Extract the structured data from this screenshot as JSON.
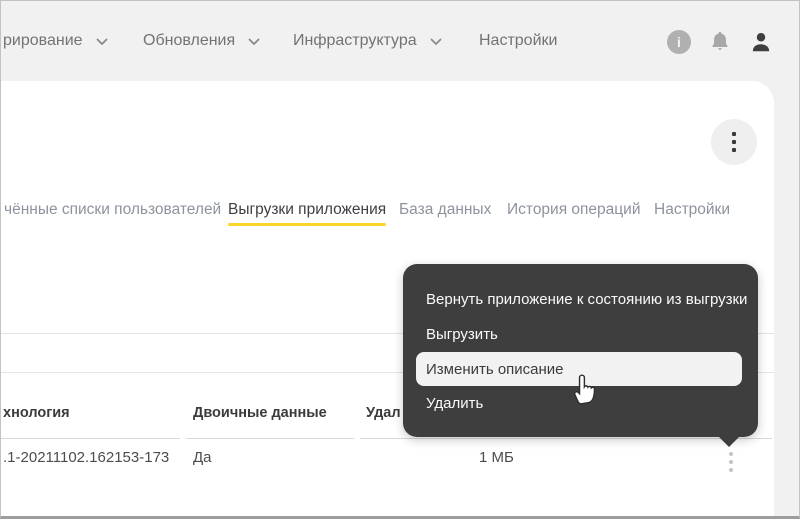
{
  "topnav": {
    "items": [
      {
        "label": "рирование",
        "has_chevron": true
      },
      {
        "label": "Обновления",
        "has_chevron": true
      },
      {
        "label": "Инфраструктура",
        "has_chevron": true
      },
      {
        "label": "Настройки",
        "has_chevron": false
      }
    ],
    "info_glyph": "i"
  },
  "tabs": [
    {
      "label": "чённые списки пользователей",
      "active": false
    },
    {
      "label": "Выгрузки приложения",
      "active": true
    },
    {
      "label": "База данных",
      "active": false
    },
    {
      "label": "История операций",
      "active": false
    },
    {
      "label": "Настройки",
      "active": false
    }
  ],
  "colors": {
    "active_tab_underline": "#fed42b",
    "menu_bg": "#3e3e3e",
    "menu_highlight_bg": "#f2f2f2",
    "topbar_bg": "#f1f1f1"
  },
  "table": {
    "headers": [
      "хнология",
      "Двоичные данные",
      "Удал"
    ],
    "row": {
      "name": ".1-20211102.162153-173",
      "binary_data": "Да",
      "size": "1 МБ"
    }
  },
  "context_menu": {
    "items": [
      {
        "label": "Вернуть приложение к состоянию из выгрузки",
        "highlighted": false
      },
      {
        "label": "Выгрузить",
        "highlighted": false
      },
      {
        "label": "Изменить описание",
        "highlighted": true
      },
      {
        "label": "Удалить",
        "highlighted": false
      }
    ]
  }
}
